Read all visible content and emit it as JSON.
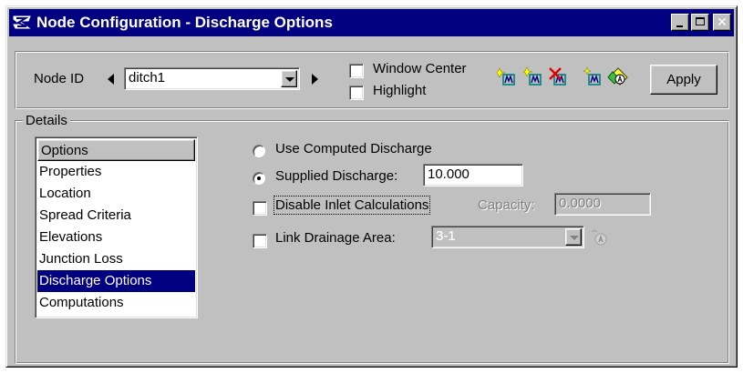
{
  "window": {
    "title": "Node Configuration - Discharge Options"
  },
  "toolbar": {
    "node_id_label": "Node ID",
    "node_id_value": "ditch1",
    "window_center_label": "Window Center",
    "highlight_label": "Highlight",
    "apply_label": "Apply"
  },
  "details": {
    "group_label": "Details",
    "list_header": "Options",
    "items": [
      "Properties",
      "Location",
      "Spread Criteria",
      "Elevations",
      "Junction Loss",
      "Discharge Options",
      "Computations"
    ],
    "selected_index": 5
  },
  "discharge": {
    "use_computed_label": "Use Computed Discharge",
    "supplied_label": "Supplied Discharge:",
    "supplied_value": "10.000",
    "disable_inlet_label": "Disable Inlet Calculations",
    "capacity_label": "Capacity:",
    "capacity_value": "0.0000",
    "link_drainage_label": "Link Drainage Area:",
    "link_drainage_value": "3-1",
    "selected_option": "supplied"
  },
  "colors": {
    "titlebar": "#000080",
    "face": "#c0c0c0",
    "selection": "#000080"
  }
}
